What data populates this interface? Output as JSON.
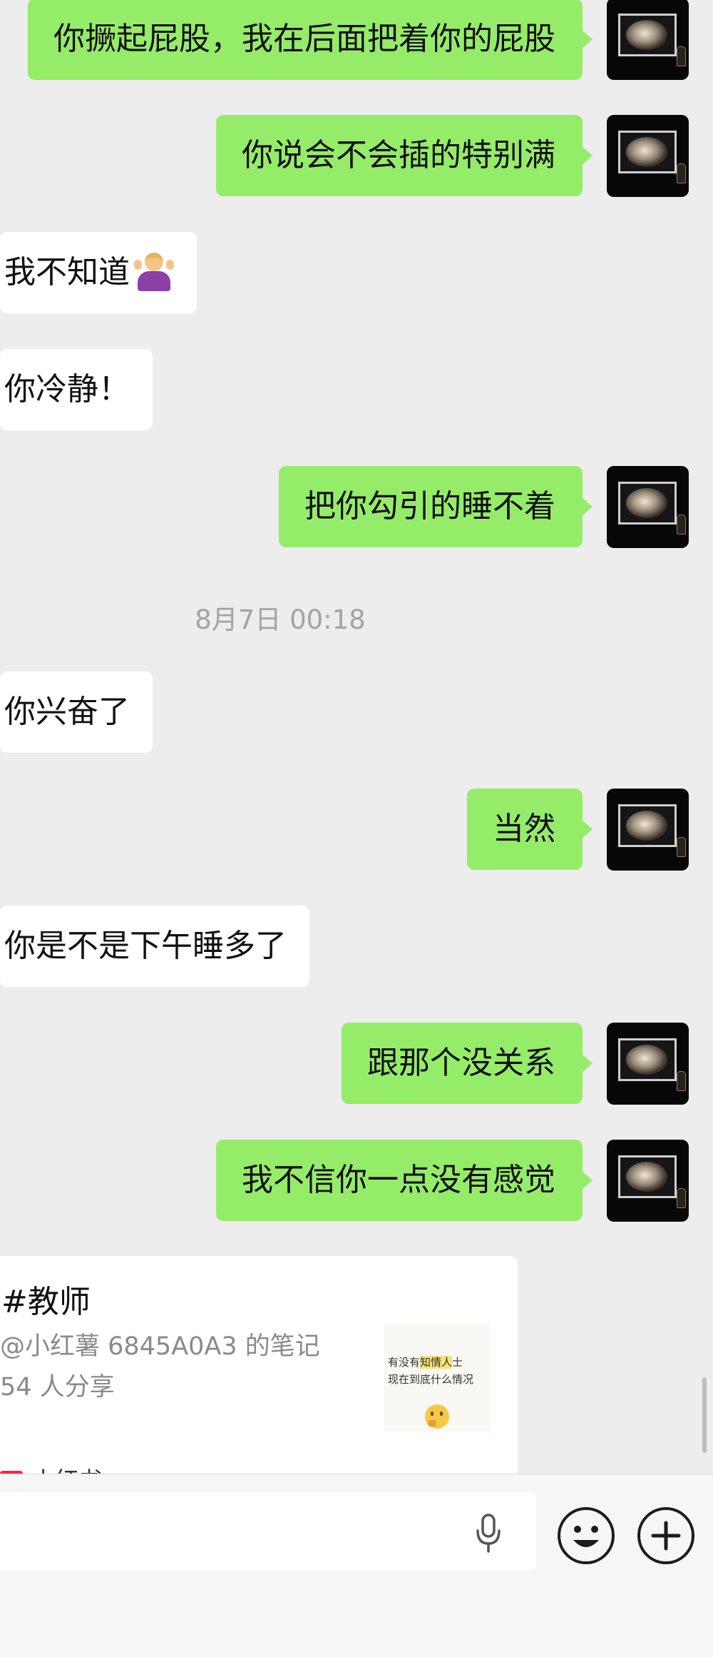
{
  "messages": {
    "m1": "你撅起屁股，我在后面把着你的屁股",
    "m2": "你说会不会插的特别满",
    "m3": "我不知道",
    "m4": "你冷静！",
    "m5": "把你勾引的睡不着",
    "timestamp": "8月7日 00:18",
    "m6": "你兴奋了",
    "m7": "当然",
    "m8": "你是不是下午睡多了",
    "m9": "跟那个没关系",
    "m10": "我不信你一点没有感觉"
  },
  "shared_card": {
    "title": "#教师",
    "note_author": "@小红薯 6845A0A3 的笔记",
    "share_count": "54 人分享",
    "thumb_line1_pre": "有没有",
    "thumb_line1_hl": "知情人",
    "thumb_line1_post": "士",
    "thumb_line2": "现在到底什么情况",
    "app_name": "小红书"
  },
  "colors": {
    "background": "#ededed",
    "outgoing_bubble": "#95ec69",
    "incoming_bubble": "#ffffff",
    "timestamp_text": "#a3a3a3",
    "app_badge": "#ff2442"
  },
  "icons": [
    "shrug-emoji",
    "microphone-icon",
    "emoji-icon",
    "plus-icon",
    "thinking-emoji"
  ]
}
